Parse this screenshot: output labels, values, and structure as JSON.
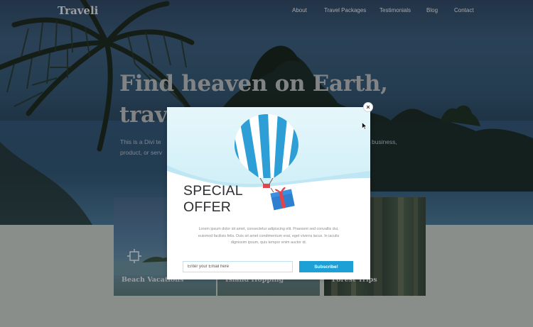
{
  "site": {
    "brand": "Traveli",
    "nav": [
      "About",
      "Travel Packages",
      "Testimonials",
      "Blog",
      "Contact"
    ],
    "hero_title_line1": "Find heaven on Earth,",
    "hero_title_line2": "trav",
    "hero_text_line1_left": "This is a Divi te",
    "hero_text_line1_right": "business,",
    "hero_text_line2_left": "product, or serv"
  },
  "cards": [
    {
      "label": "Beach Vacations",
      "icon": "crosshair-icon"
    },
    {
      "label": "Island Hopping"
    },
    {
      "label": "Forest Trips"
    }
  ],
  "popup": {
    "title_line1": "SPECIAL",
    "title_line2": "OFFER",
    "body_lines": [
      "Lorem ipsum dolor sit amet, consectetur adipiscing elit. Praesent sed convallis dui,",
      "euismod facilisis felis. Duis sit amet condimentum erat, eget viverra lacus. In iaculis",
      "dignissim ipsum, quis tempor enim auctor id."
    ],
    "email_placeholder": "Enter your Email here",
    "subscribe_label": "Subscribe!",
    "close_symbol": "×"
  },
  "colors": {
    "accent": "#1ca0d5",
    "balloon_stripe": "#2d9fd6",
    "gift": "#2f7fd0",
    "ribbon": "#e3444c"
  }
}
